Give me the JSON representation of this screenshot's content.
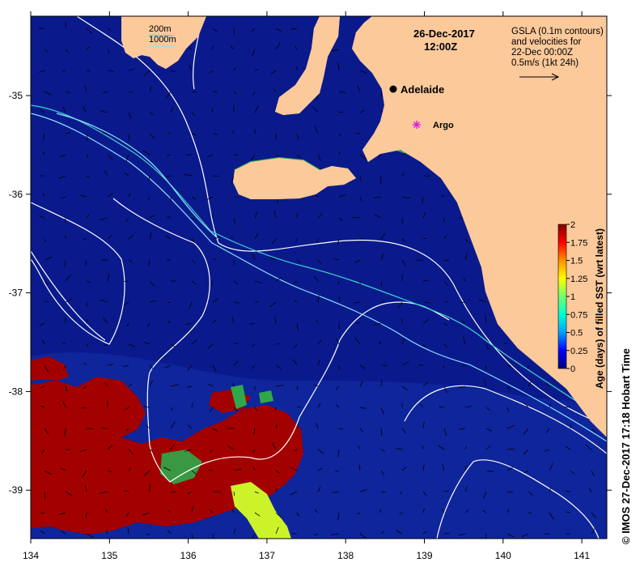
{
  "map": {
    "date_line": "26-Dec-2017",
    "time_line": "12:00Z",
    "legend_lines": [
      "GSLA (0.1m contours)",
      "and velocities for",
      "22-Dec 00:00Z",
      "0.5m/s (1kt 24h)"
    ],
    "isobath_labels": [
      "200m",
      "1000m"
    ],
    "places": [
      {
        "name": "Adelaide",
        "marker": "black-dot"
      },
      {
        "name": "Argo",
        "marker": "magenta-star"
      }
    ],
    "x_ticks": [
      "134",
      "135",
      "136",
      "137",
      "138",
      "139",
      "140",
      "141"
    ],
    "y_ticks": [
      "-35",
      "-36",
      "-37",
      "-38",
      "-39"
    ],
    "colors": {
      "ocean": "#0a1a8c",
      "land": "#fbc99a",
      "old_sst": "#a30000",
      "green_patch": "#2fa84a",
      "yellow_green": "#ccf32a",
      "contour": "#ffffff",
      "isobath_200": "#40d0d0",
      "isobath_1000": "#8fe3ff"
    }
  },
  "colorbar": {
    "title": "Age (days) of filled SST (wrt latest)",
    "ticks": [
      "2",
      "1.75",
      "1.5",
      "1.25",
      "1",
      "0.75",
      "0.5",
      "0.25",
      "0"
    ],
    "gradient": [
      "#00007f",
      "#0000ff",
      "#00a0ff",
      "#00ffd0",
      "#70ff70",
      "#ffff00",
      "#ff9000",
      "#ff0000",
      "#7f0000"
    ]
  },
  "credit": "© IMOS 27-Dec-2017 17:18 Hobart Time"
}
